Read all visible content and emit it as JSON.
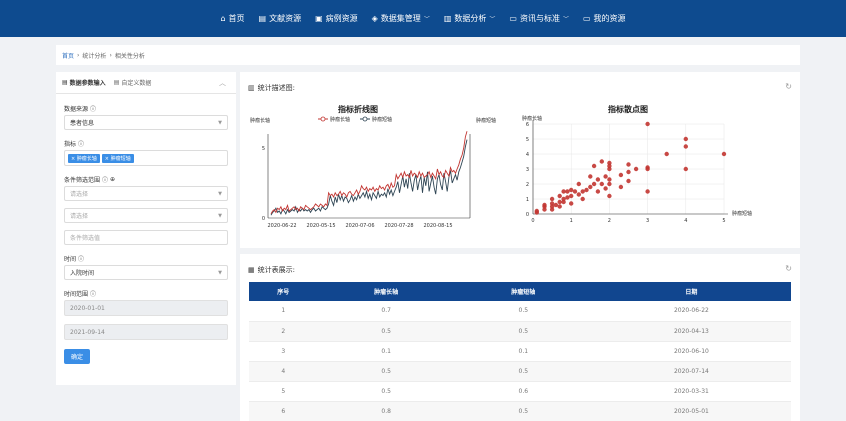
{
  "nav": {
    "items": [
      {
        "icon": "home-icon",
        "glyph": "⌂",
        "label": "首页",
        "caret": false
      },
      {
        "icon": "book-icon",
        "glyph": "▤",
        "label": "文献资源",
        "caret": false
      },
      {
        "icon": "case-icon",
        "glyph": "▣",
        "label": "病例资源",
        "caret": false
      },
      {
        "icon": "layers-icon",
        "glyph": "◈",
        "label": "数据集管理",
        "caret": true
      },
      {
        "icon": "bar-chart-icon",
        "glyph": "▥",
        "label": "数据分析",
        "caret": true
      },
      {
        "icon": "news-icon",
        "glyph": "▭",
        "label": "资讯与标准",
        "caret": true
      },
      {
        "icon": "folder-icon",
        "glyph": "▭",
        "label": "我的资源",
        "caret": false
      }
    ],
    "bg": "#0e4b8f"
  },
  "breadcrumb": {
    "home": "首页",
    "sep": "›",
    "level1": "统计分析",
    "level2": "相关性分析"
  },
  "left": {
    "tab_active": "数据参数输入",
    "tab_other": "自定义数据",
    "collapse_icon": "︿",
    "source_label": "数据来源",
    "source_value": "患者信息",
    "metric_label": "指标",
    "metric_tags": [
      "肿瘤长轴",
      "肿瘤短轴"
    ],
    "filter_label": "条件筛选范围",
    "filter_select_1": "请选择",
    "filter_select_2": "请选择",
    "filter_placeholder": "条件筛选值",
    "time_label": "时间",
    "time_value": "入院时间",
    "range_label": "时间范围",
    "range_start": "2020-01-01",
    "range_end": "2021-09-14",
    "confirm": "确定"
  },
  "desc_panel": {
    "title": "统计描述图:",
    "refresh_icon": "refresh-icon"
  },
  "table_panel": {
    "title": "统计表展示:",
    "columns": [
      "序号",
      "肿瘤长轴",
      "肿瘤短轴",
      "日期"
    ],
    "rows": [
      [
        "1",
        "0.7",
        "0.5",
        "2020-06-22"
      ],
      [
        "2",
        "0.5",
        "0.5",
        "2020-04-13"
      ],
      [
        "3",
        "0.1",
        "0.1",
        "2020-06-10"
      ],
      [
        "4",
        "0.5",
        "0.5",
        "2020-07-14"
      ],
      [
        "5",
        "0.5",
        "0.6",
        "2020-03-31"
      ],
      [
        "6",
        "0.8",
        "0.5",
        "2020-05-01"
      ]
    ]
  },
  "chart_data": [
    {
      "type": "line",
      "title": "指标折线图",
      "ylabel_left": "肿瘤长轴",
      "ylabel_right": "肿瘤短轴",
      "legend": "top-center",
      "ylim": [
        0,
        6
      ],
      "yticks": [
        "0",
        "5"
      ],
      "x_tick_labels": [
        "2020-06-22",
        "2020-05-15",
        "2020-07-06",
        "2020-07-28",
        "2020-08-15"
      ],
      "series": [
        {
          "name": "肿瘤长轴",
          "color": "#c23531",
          "values": [
            0.3,
            0.5,
            0.6,
            0.4,
            0.7,
            0.6,
            0.8,
            0.5,
            0.7,
            0.6,
            0.9,
            0.5,
            0.6,
            0.7,
            0.8,
            0.6,
            0.7,
            0.5,
            0.8,
            0.7,
            0.6,
            0.9,
            0.8,
            0.7,
            0.6,
            0.7,
            0.8,
            1.0,
            0.9,
            0.8,
            1.0,
            0.9,
            0.8,
            1.0,
            0.9,
            1.8,
            1.6,
            1.7,
            1.5,
            1.8,
            1.6,
            1.7,
            1.9,
            1.6,
            1.8,
            1.7,
            1.5,
            1.8,
            1.9,
            1.7,
            1.6,
            1.8,
            2.0,
            1.7,
            1.9,
            2.3,
            2.1,
            2.0,
            2.2,
            1.9,
            2.1,
            2.0,
            2.2,
            1.9,
            2.1,
            2.0,
            2.3,
            2.1,
            2.2,
            2.0,
            2.3,
            2.4,
            2.1,
            2.5,
            2.2,
            2.3,
            3.1,
            2.8,
            3.0,
            3.2,
            2.9,
            3.3,
            3.0,
            3.1,
            2.9,
            3.4,
            3.0,
            3.2,
            3.1,
            2.9,
            3.3,
            3.0,
            3.2,
            2.9,
            3.0,
            3.1,
            3.3,
            2.9,
            3.2,
            3.0,
            2.8,
            3.5,
            3.1,
            3.3,
            3.0,
            2.9,
            3.4,
            3.2,
            3.0,
            3.6,
            3.3,
            3.4,
            3.2,
            3.5,
            3.8,
            4.2,
            4.5,
            5.0,
            5.8,
            6.2
          ]
        },
        {
          "name": "肿瘤短轴",
          "color": "#2f4554",
          "values": [
            0.2,
            0.4,
            0.5,
            0.7,
            0.4,
            0.5,
            0.3,
            0.6,
            0.5,
            0.3,
            0.6,
            0.4,
            0.5,
            0.6,
            0.5,
            0.8,
            0.4,
            0.6,
            0.5,
            0.7,
            0.5,
            0.6,
            0.5,
            0.6,
            0.4,
            0.6,
            0.7,
            0.5,
            0.6,
            0.7,
            0.5,
            0.8,
            0.7,
            0.6,
            0.7,
            1.0,
            1.6,
            1.2,
            0.9,
            1.5,
            1.1,
            1.7,
            1.3,
            1.6,
            1.2,
            1.5,
            1.4,
            1.1,
            1.3,
            1.6,
            1.2,
            1.5,
            1.3,
            1.7,
            1.4,
            1.6,
            1.8,
            1.5,
            1.9,
            1.4,
            1.7,
            1.3,
            1.8,
            1.6,
            1.4,
            1.9,
            1.5,
            1.7,
            1.6,
            1.8,
            1.5,
            2.1,
            1.7,
            2.0,
            1.6,
            1.9,
            2.2,
            2.6,
            1.8,
            2.4,
            3.0,
            2.2,
            2.8,
            2.1,
            3.2,
            2.5,
            1.9,
            2.7,
            3.1,
            2.0,
            2.6,
            3.0,
            1.8,
            2.9,
            2.3,
            3.3,
            1.9,
            2.5,
            3.0,
            2.2,
            1.7,
            2.8,
            3.1,
            2.4,
            2.0,
            3.2,
            2.6,
            1.9,
            2.9,
            3.4,
            2.5,
            2.8,
            3.1,
            2.7,
            3.3,
            3.6,
            4.0,
            4.4,
            5.1,
            5.6
          ]
        }
      ]
    },
    {
      "type": "scatter",
      "title": "指标散点图",
      "xlabel": "肿瘤短轴",
      "ylabel": "肿瘤长轴",
      "xlim": [
        0,
        5
      ],
      "ylim": [
        0,
        6
      ],
      "xticks": [
        0,
        1,
        2,
        3,
        4,
        5
      ],
      "yticks": [
        0,
        1,
        2,
        3,
        4,
        5,
        6
      ],
      "color": "#c23531",
      "points": [
        [
          0.1,
          0.1
        ],
        [
          0.1,
          0.2
        ],
        [
          0.3,
          0.3
        ],
        [
          0.3,
          0.5
        ],
        [
          0.3,
          0.6
        ],
        [
          0.5,
          0.3
        ],
        [
          0.5,
          0.5
        ],
        [
          0.5,
          0.7
        ],
        [
          0.5,
          1.0
        ],
        [
          0.6,
          0.6
        ],
        [
          0.7,
          0.5
        ],
        [
          0.7,
          0.8
        ],
        [
          0.7,
          1.2
        ],
        [
          0.8,
          0.8
        ],
        [
          0.8,
          1.0
        ],
        [
          0.8,
          1.5
        ],
        [
          0.9,
          1.1
        ],
        [
          0.9,
          1.5
        ],
        [
          1.0,
          0.7
        ],
        [
          1.0,
          1.2
        ],
        [
          1.0,
          1.6
        ],
        [
          1.1,
          1.5
        ],
        [
          1.2,
          2.0
        ],
        [
          1.2,
          1.3
        ],
        [
          1.3,
          1.0
        ],
        [
          1.3,
          1.5
        ],
        [
          1.4,
          1.6
        ],
        [
          1.5,
          1.8
        ],
        [
          1.5,
          2.5
        ],
        [
          1.6,
          2.0
        ],
        [
          1.6,
          3.2
        ],
        [
          1.7,
          1.5
        ],
        [
          1.7,
          2.3
        ],
        [
          1.8,
          2.0
        ],
        [
          1.8,
          3.5
        ],
        [
          1.9,
          2.5
        ],
        [
          1.9,
          1.7
        ],
        [
          2.0,
          1.2
        ],
        [
          2.0,
          2.0
        ],
        [
          2.0,
          2.3
        ],
        [
          2.0,
          3.0
        ],
        [
          2.0,
          3.2
        ],
        [
          2.0,
          3.4
        ],
        [
          2.3,
          1.8
        ],
        [
          2.3,
          2.6
        ],
        [
          2.5,
          2.8
        ],
        [
          2.5,
          2.2
        ],
        [
          2.5,
          3.3
        ],
        [
          2.7,
          3.0
        ],
        [
          3.0,
          1.5
        ],
        [
          3.0,
          3.0
        ],
        [
          3.0,
          3.1
        ],
        [
          3.0,
          6.0
        ],
        [
          3.5,
          4.0
        ],
        [
          4.0,
          3.0
        ],
        [
          4.0,
          4.5
        ],
        [
          4.0,
          5.0
        ],
        [
          5.0,
          4.0
        ]
      ]
    }
  ]
}
